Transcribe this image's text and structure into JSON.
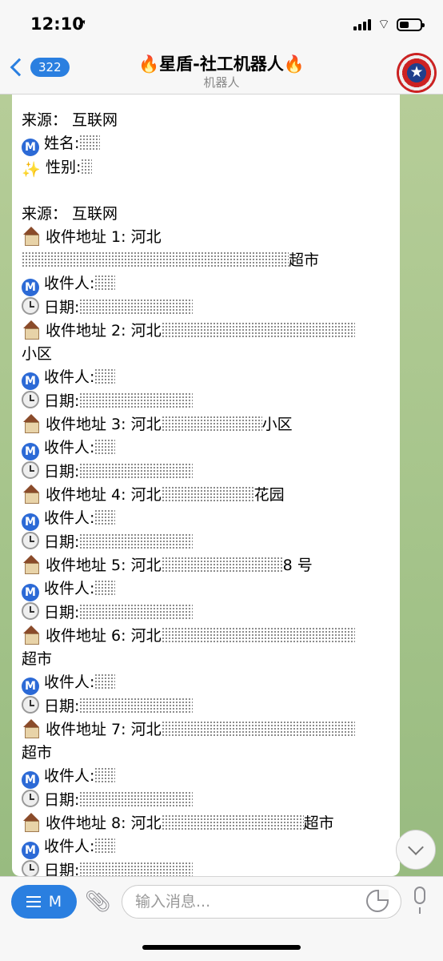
{
  "status_bar": {
    "time": "12:10",
    "location_icon": "location-arrow-icon"
  },
  "nav": {
    "back_count": "322",
    "title": "🔥星盾-社工机器人🔥",
    "subtitle": "机器人",
    "avatar_icon": "captain-shield-avatar"
  },
  "message": {
    "block1": {
      "source": "来源： 互联网",
      "name_label": "姓名:",
      "gender_label": "性别:"
    },
    "block2": {
      "source": "来源： 互联网",
      "addr1": "收件地址 1: 河北",
      "addr1_end": "超市",
      "recipient_label": "收件人:",
      "date_label": "日期:",
      "addr2": "收件地址 2: 河北",
      "addr2_wrap": "小区",
      "addr3": "收件地址 3: 河北",
      "addr3_end": "小区",
      "addr4": "收件地址 4: 河北",
      "addr4_end": "花园",
      "addr5": "收件地址 5: 河北",
      "addr5_end": "8 号",
      "addr6": "收件地址 6: 河北",
      "addr6_wrap": "超市",
      "addr7": "收件地址 7: 河北",
      "addr7_wrap": "超市",
      "addr8": "收件地址 8: 河北",
      "addr8_end": "超市"
    }
  },
  "input": {
    "menu_label": "M",
    "placeholder": "输入消息..."
  }
}
